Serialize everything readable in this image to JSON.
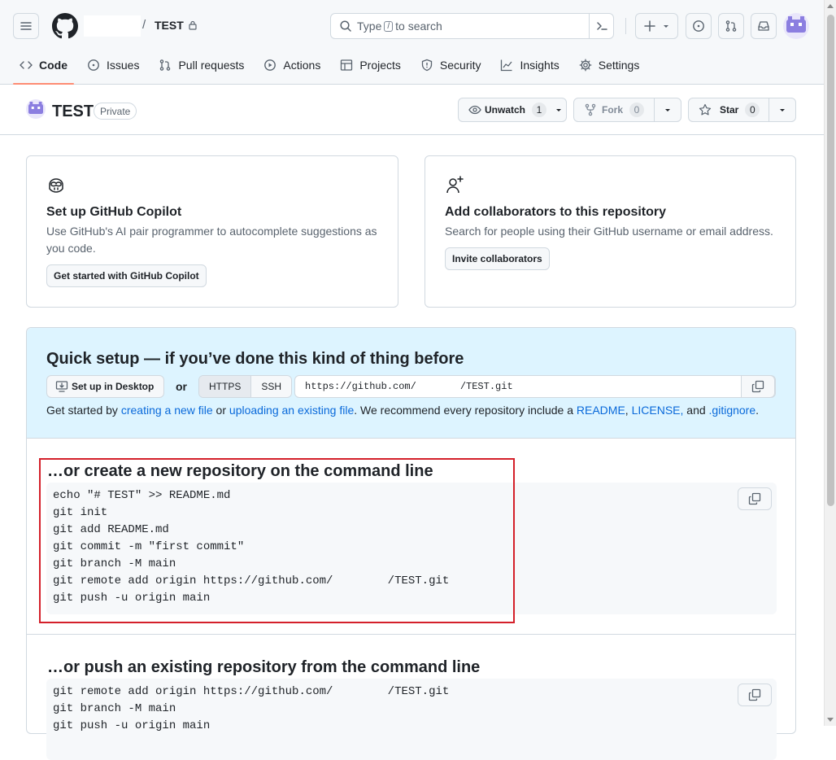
{
  "header": {
    "repo_name": "TEST",
    "separator": "/",
    "search_before": "Type",
    "search_key": "/",
    "search_after": "to search"
  },
  "tabs": [
    {
      "label": "Code",
      "icon": "code-icon"
    },
    {
      "label": "Issues",
      "icon": "issue-icon"
    },
    {
      "label": "Pull requests",
      "icon": "pull-request-icon"
    },
    {
      "label": "Actions",
      "icon": "play-icon"
    },
    {
      "label": "Projects",
      "icon": "table-icon"
    },
    {
      "label": "Security",
      "icon": "shield-icon"
    },
    {
      "label": "Insights",
      "icon": "graph-icon"
    },
    {
      "label": "Settings",
      "icon": "gear-icon"
    }
  ],
  "repo": {
    "name": "TEST",
    "visibility": "Private",
    "unwatch_label": "Unwatch",
    "watch_count": "1",
    "fork_label": "Fork",
    "fork_count": "0",
    "star_label": "Star",
    "star_count": "0"
  },
  "copilot_card": {
    "title": "Set up GitHub Copilot",
    "description": "Use GitHub's AI pair programmer to autocomplete suggestions as you code.",
    "button": "Get started with GitHub Copilot"
  },
  "collab_card": {
    "title": "Add collaborators to this repository",
    "description": "Search for people using their GitHub username or email address.",
    "button": "Invite collaborators"
  },
  "quick_setup": {
    "title": "Quick setup — if you’ve done this kind of thing before",
    "desktop_button": "Set up in Desktop",
    "or": "or",
    "https_label": "HTTPS",
    "ssh_label": "SSH",
    "url_prefix": "https://github.com/",
    "url_suffix": "/TEST.git",
    "hint_start": "Get started by ",
    "link_new_file": "creating a new file",
    "hint_or": " or ",
    "link_upload": "uploading an existing file",
    "hint_mid": ". We recommend every repository include a ",
    "link_readme": "README",
    "comma1": ", ",
    "link_license": "LICENSE,",
    "hint_and": " and ",
    "link_gitignore": ".gitignore",
    "hint_end": "."
  },
  "new_repo": {
    "title": "…or create a new repository on the command line",
    "lines": [
      "echo \"# TEST\" >> README.md",
      "git init",
      "git add README.md",
      "git commit -m \"first commit\"",
      "git branch -M main",
      "git remote add origin https://github.com/        /TEST.git",
      "git push -u origin main"
    ]
  },
  "push_repo": {
    "title": "…or push an existing repository from the command line",
    "lines": [
      "git remote add origin https://github.com/        /TEST.git",
      "git branch -M main",
      "git push -u origin main"
    ]
  }
}
